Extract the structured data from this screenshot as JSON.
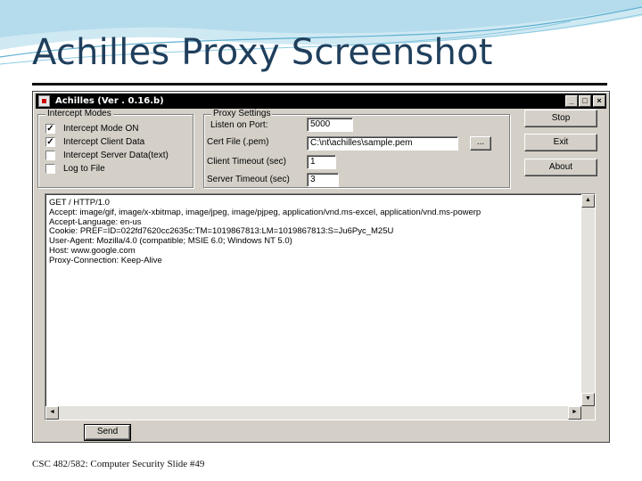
{
  "slide": {
    "title": "Achilles Proxy Screenshot",
    "footer": "CSC 482/582: Computer Security    Slide #49"
  },
  "window": {
    "title": "Achilles (Ver . 0.16.b)",
    "controls": {
      "minimize": "_",
      "maximize": "□",
      "close": "×"
    }
  },
  "intercept_modes": {
    "legend": "Intercept Modes",
    "items": [
      {
        "label": "Intercept Mode ON",
        "checked": true
      },
      {
        "label": "Intercept Client Data",
        "checked": true
      },
      {
        "label": "Intercept Server Data(text)",
        "checked": false
      },
      {
        "label": "Log to File",
        "checked": false
      }
    ]
  },
  "proxy_settings": {
    "legend": "Proxy Settings",
    "listen_label": "Listen on Port:",
    "listen_value": "5000",
    "cert_label": "Cert File (.pem)",
    "cert_value": "C:\\nt\\achilles\\sample.pem",
    "browse_label": "...",
    "client_timeout_label": "Client Timeout (sec)",
    "client_timeout_value": "1",
    "server_timeout_label": "Server Timeout (sec)",
    "server_timeout_value": "3"
  },
  "buttons": {
    "stop": "Stop",
    "exit": "Exit",
    "about": "About",
    "send": "Send"
  },
  "request_lines": [
    "GET / HTTP/1.0",
    "Accept: image/gif, image/x-xbitmap, image/jpeg, image/pjpeg, application/vnd.ms-excel, application/vnd.ms-powerp",
    "Accept-Language: en-us",
    "Cookie: PREF=ID=022fd7620cc2635c:TM=1019867813:LM=1019867813:S=Ju6Pyc_M25U",
    "User-Agent: Mozilla/4.0 (compatible; MSIE 6.0; Windows NT 5.0)",
    "Host: www.google.com",
    "Proxy-Connection: Keep-Alive"
  ],
  "scroll_arrows": {
    "up": "▲",
    "down": "▼",
    "left": "◄",
    "right": "►"
  },
  "colors": {
    "title_text": "#1f3f5c",
    "dialog_face": "#d4d0c8",
    "titlebar": "#000000"
  }
}
